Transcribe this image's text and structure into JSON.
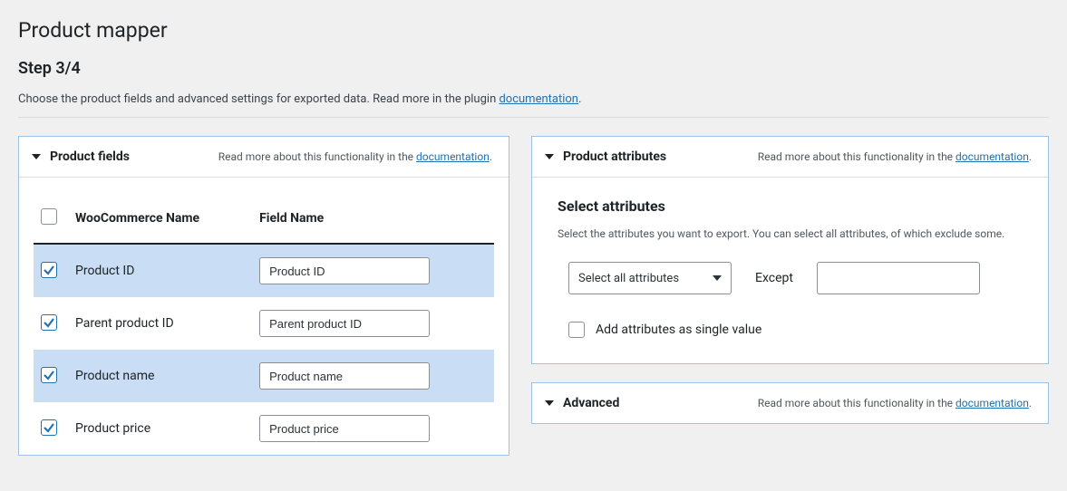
{
  "header": {
    "title": "Product mapper",
    "step": "Step 3/4",
    "intro_prefix": "Choose the product fields and advanced settings for exported data. Read more in the plugin ",
    "intro_link": "documentation",
    "intro_suffix": "."
  },
  "panels": {
    "fields": {
      "title": "Product fields",
      "help_prefix": "Read more about this functionality in the ",
      "help_link": "documentation",
      "help_suffix": "."
    },
    "attributes": {
      "title": "Product attributes",
      "help_prefix": "Read more about this functionality in the ",
      "help_link": "documentation",
      "help_suffix": "."
    },
    "advanced": {
      "title": "Advanced",
      "help_prefix": "Read more about this functionality in the ",
      "help_link": "documentation",
      "help_suffix": "."
    }
  },
  "table": {
    "col_wc": "WooCommerce Name",
    "col_field": "Field Name",
    "rows": [
      {
        "wc": "Product ID",
        "field": "Product ID",
        "checked": true
      },
      {
        "wc": "Parent product ID",
        "field": "Parent product ID",
        "checked": true
      },
      {
        "wc": "Product name",
        "field": "Product name",
        "checked": true
      },
      {
        "wc": "Product price",
        "field": "Product price",
        "checked": true
      }
    ]
  },
  "attributes": {
    "heading": "Select attributes",
    "desc": "Select the attributes you want to export. You can select all attributes, of which exclude some.",
    "select_label": "Select all attributes",
    "except_label": "Except",
    "single_label": "Add attributes as single value"
  }
}
